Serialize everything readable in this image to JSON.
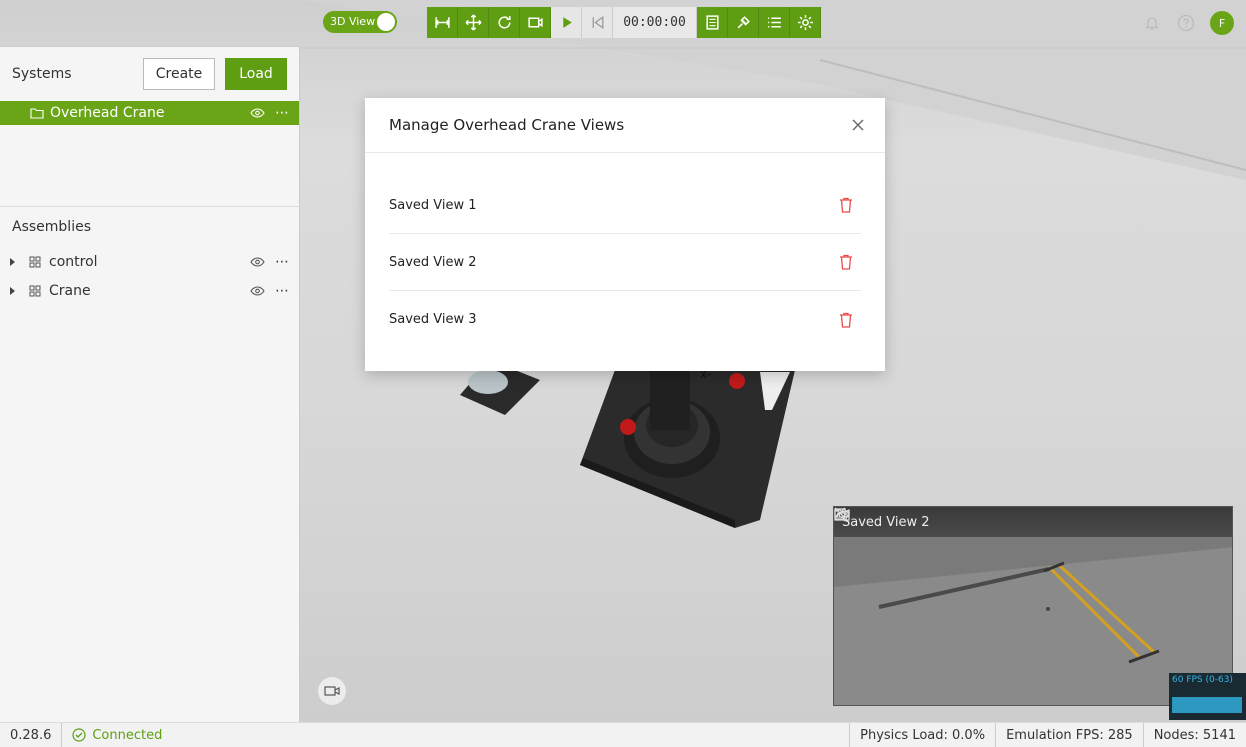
{
  "toolbar": {
    "view_toggle_label": "3D View",
    "timer": "00:00:00",
    "icons": [
      "measure-icon",
      "move-icon",
      "rotate-icon",
      "camera-view-icon",
      "play-icon",
      "skip-back-icon",
      "panel-icon",
      "link-icon",
      "list-icon",
      "settings-icon"
    ]
  },
  "header": {
    "avatar_initial": "F"
  },
  "systems": {
    "title": "Systems",
    "create_label": "Create",
    "load_label": "Load",
    "items": [
      {
        "label": "Overhead Crane"
      }
    ]
  },
  "assemblies": {
    "title": "Assemblies",
    "items": [
      {
        "label": "control"
      },
      {
        "label": "Crane"
      }
    ]
  },
  "modal": {
    "title": "Manage Overhead Crane Views",
    "views": [
      {
        "label": "Saved View 1"
      },
      {
        "label": "Saved View 2"
      },
      {
        "label": "Saved View 3"
      }
    ]
  },
  "preview": {
    "title": "Saved View 2",
    "fps_label": "60 FPS (0-63)"
  },
  "status": {
    "version": "0.28.6",
    "connection": "Connected",
    "physics_load": "Physics Load: 0.0%",
    "emulation_fps": "Emulation FPS: 285",
    "nodes": "Nodes: 5141"
  },
  "colors": {
    "accent": "#6aa517",
    "accent_dark": "#5f9d12",
    "danger": "#e84a4a"
  }
}
